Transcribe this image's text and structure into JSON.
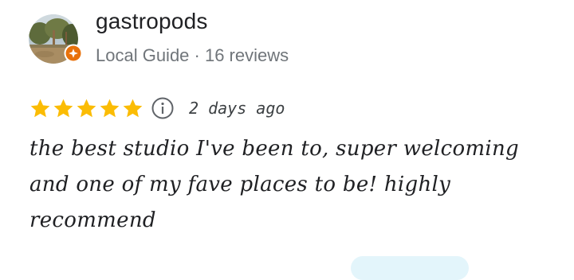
{
  "reviewer": {
    "name": "gastropods",
    "meta": "Local Guide · 16 reviews"
  },
  "rating": {
    "stars": 5,
    "max": 5,
    "date": "2 days ago"
  },
  "review": {
    "text": "the best studio I've been to, super welcoming and one of my fave places to be! highly recommend"
  },
  "colors": {
    "star": "#fbbc04",
    "badge": "#e8710a",
    "name": "#202124",
    "meta": "#70757a"
  },
  "icons": {
    "badge": "local-guide-badge-icon",
    "info": "info-icon",
    "star": "star-icon"
  }
}
